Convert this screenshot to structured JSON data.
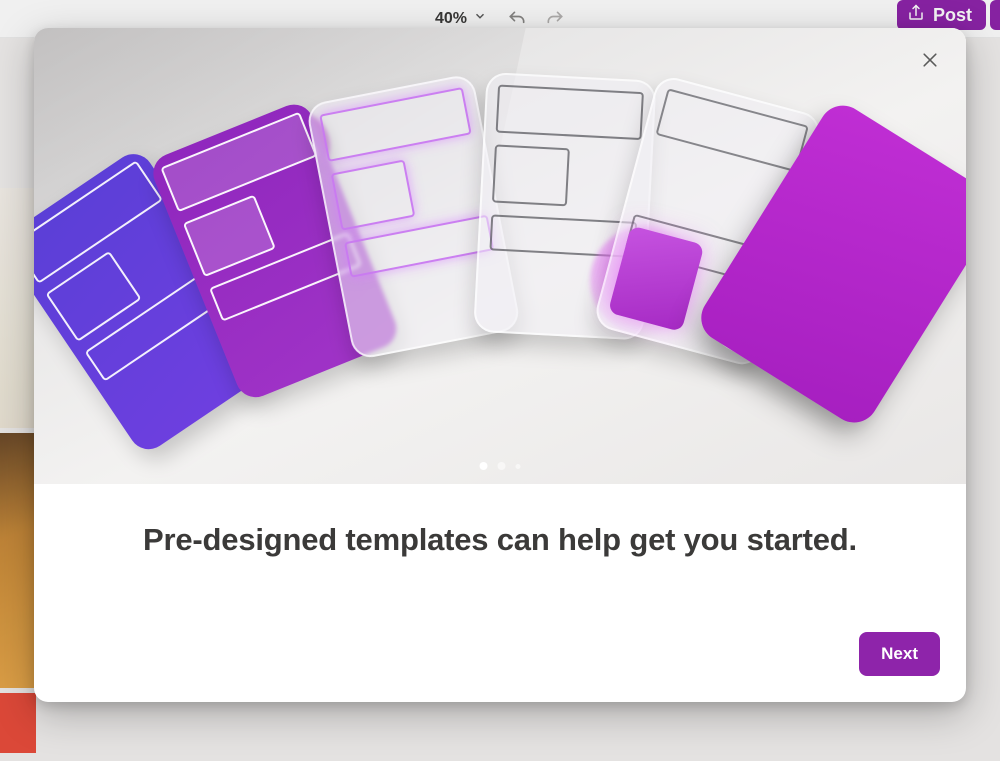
{
  "toolbar": {
    "zoom_value": "40%",
    "undo_icon": "undo-icon",
    "redo_icon": "redo-icon"
  },
  "post_button": {
    "label": "Post"
  },
  "modal": {
    "headline": "Pre-designed templates can help get you started.",
    "close_label": "Close",
    "next_label": "Next",
    "pagination": {
      "current": 1,
      "total": 3
    }
  },
  "colors": {
    "brand": "#8e24aa",
    "magenta_accent": "#c02ed4",
    "violet_accent": "#5a3fd6"
  }
}
